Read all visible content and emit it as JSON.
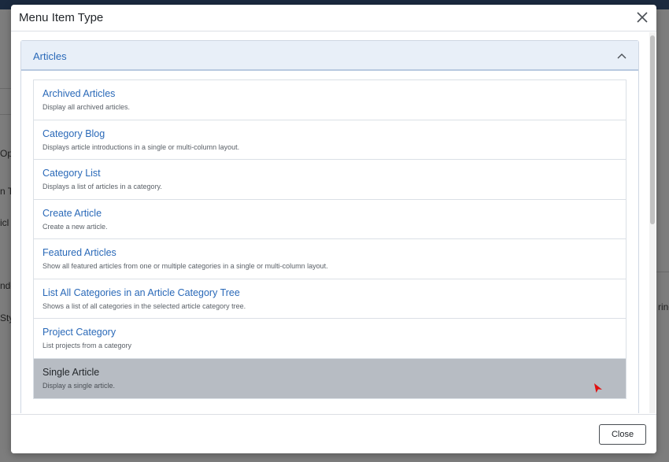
{
  "modal": {
    "title": "Menu Item Type",
    "close_button_label": "Close"
  },
  "accordion": {
    "label": "Articles",
    "items": [
      {
        "title": "Archived Articles",
        "description": "Display all archived articles."
      },
      {
        "title": "Category Blog",
        "description": "Displays article introductions in a single or multi-column layout."
      },
      {
        "title": "Category List",
        "description": "Displays a list of articles in a category."
      },
      {
        "title": "Create Article",
        "description": "Create a new article."
      },
      {
        "title": "Featured Articles",
        "description": "Show all featured articles from one or multiple categories in a single or multi-column layout."
      },
      {
        "title": "List All Categories in an Article Category Tree",
        "description": "Shows a list of all categories in the selected article category tree."
      },
      {
        "title": "Project Category",
        "description": "List projects from a category"
      },
      {
        "title": "Single Article",
        "description": "Display a single article."
      }
    ],
    "selected_item": "Single Article"
  },
  "background": {
    "fragments": [
      "Op",
      "n T",
      "icl",
      "nde",
      "Sty",
      "ring"
    ]
  },
  "colors": {
    "link": "#2a69b8",
    "accordion_header_bg": "#e8eff8",
    "selected_row_bg": "#b7bcc3",
    "cursor": "#e01010"
  },
  "icons": {
    "close": "close-icon",
    "collapse": "chevron-up-icon",
    "pointer": "mouse-pointer-icon"
  }
}
